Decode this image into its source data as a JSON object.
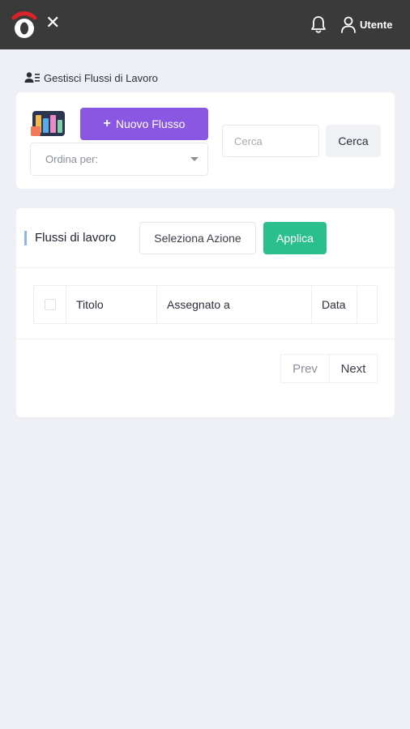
{
  "header": {
    "logo_icon": "opera-logo-icon",
    "close_icon": "close-icon",
    "close_glyph": "✕",
    "notifications_icon": "bell-icon",
    "user_icon": "user-icon",
    "user_label": "Utente",
    "background": "#3a3a3a"
  },
  "page": {
    "title": "Gestisci Flussi di Lavoro",
    "title_icon": "user-list-icon"
  },
  "toolbar": {
    "app_icon": "kanban-board-icon",
    "new_flow_plus": "+",
    "new_flow_label": "Nuovo Flusso",
    "sort_placeholder": "Ordina per:",
    "search_placeholder": "Cerca",
    "search_button_label": "Cerca",
    "accent_color": "#8a57e2"
  },
  "workflows": {
    "section_title": "Flussi di lavoro",
    "action_select_label": "Seleziona Azione",
    "apply_label": "Applica",
    "apply_color": "#2bbf8e",
    "columns": [
      "Titolo",
      "Assegnato a",
      "Data"
    ],
    "rows": [],
    "pagination": {
      "prev_label": "Prev",
      "next_label": "Next"
    }
  }
}
